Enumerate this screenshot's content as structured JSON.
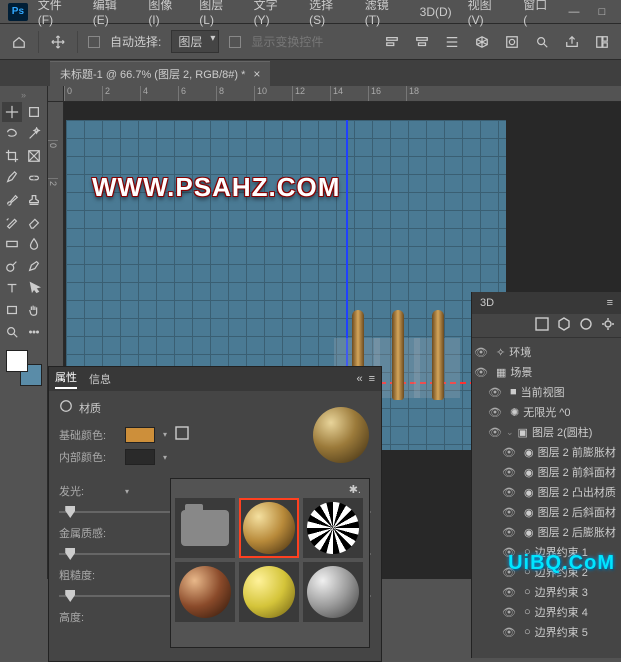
{
  "menu": {
    "items": [
      "文件(F)",
      "编辑(E)",
      "图像(I)",
      "图层(L)",
      "文字(Y)",
      "选择(S)",
      "滤镜(T)",
      "3D(D)",
      "视图(V)",
      "窗口("
    ]
  },
  "win": {
    "min": "—",
    "max": "□",
    "close": ""
  },
  "options": {
    "auto_select": "自动选择:",
    "target": "图层",
    "show_controls": "显示变换控件"
  },
  "doc_tab": {
    "title": "未标题-1 @ 66.7% (图层 2, RGB/8#) *",
    "close": "×"
  },
  "ruler_h": [
    "0",
    "2",
    "4",
    "6",
    "8",
    "10",
    "12",
    "14",
    "16",
    "18"
  ],
  "ruler_v": [
    "",
    "0",
    "2"
  ],
  "watermark": "WWW.PSAHZ.COM",
  "properties": {
    "tab_props": "属性",
    "tab_info": "信息",
    "section": "材质",
    "base_color": "基础颜色:",
    "inner_color": "内部颜色:",
    "glow": "发光:",
    "metal": "金属质感:",
    "rough": "粗糙度:",
    "height": "高度:",
    "base_swatch": "#cd8f3a",
    "inner_swatch": "#2a2a2a"
  },
  "panel3d": {
    "tab": "3D",
    "items": [
      {
        "icon": "env",
        "label": "环境",
        "ind": 0
      },
      {
        "icon": "scene",
        "label": "场景",
        "ind": 0
      },
      {
        "icon": "cam",
        "label": "当前视图",
        "ind": 1
      },
      {
        "icon": "light",
        "label": "无限光 ^0",
        "ind": 1
      },
      {
        "icon": "mesh",
        "label": "图层 2(圆柱)",
        "ind": 1,
        "expand": "⌄"
      },
      {
        "icon": "mat",
        "label": "图层 2 前膨胀材",
        "ind": 2
      },
      {
        "icon": "mat",
        "label": "图层 2 前斜面材",
        "ind": 2
      },
      {
        "icon": "mat",
        "label": "图层 2 凸出材质",
        "ind": 2
      },
      {
        "icon": "mat",
        "label": "图层 2 后斜面材",
        "ind": 2
      },
      {
        "icon": "mat",
        "label": "图层 2 后膨胀材",
        "ind": 2
      },
      {
        "icon": "con",
        "label": "边界约束 1",
        "ind": 2
      },
      {
        "icon": "con",
        "label": "边界约束 2",
        "ind": 2
      },
      {
        "icon": "con",
        "label": "边界约束 3",
        "ind": 2
      },
      {
        "icon": "con",
        "label": "边界约束 4",
        "ind": 2
      },
      {
        "icon": "con",
        "label": "边界约束 5",
        "ind": 2
      }
    ]
  },
  "uibq": "UiBQ.CoM"
}
